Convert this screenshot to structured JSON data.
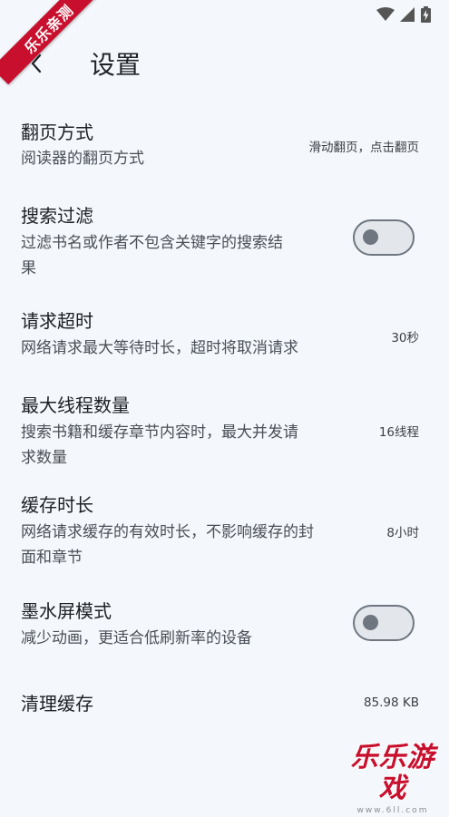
{
  "status_bar": {
    "icons": [
      "wifi-icon",
      "signal-icon",
      "battery-charging-icon"
    ]
  },
  "watermark": {
    "corner_text": "乐乐亲测",
    "bottom_text": "乐乐游戏",
    "bottom_url": "www.6ll.com"
  },
  "app_bar": {
    "back_icon": "chevron-left-icon",
    "title": "设置"
  },
  "settings": [
    {
      "title": "翻页方式",
      "description": "阅读器的翻页方式",
      "value": "滑动翻页，点击翻页"
    },
    {
      "title": "搜索过滤",
      "description": "过滤书名或作者不包含关键字的搜索结",
      "description_2": "果",
      "toggle_on": false
    },
    {
      "title": "请求超时",
      "description": "网络请求最大等待时长，超时将取消请求",
      "value": "30秒"
    },
    {
      "title": "最大线程数量",
      "description": "搜索书籍和缓存章节内容时，最大并发请",
      "description_2": "求数量",
      "value": "16线程"
    },
    {
      "title": "缓存时长",
      "description": "网络请求缓存的有效时长，不影响缓存的封",
      "description_2": "面和章节",
      "value": "8小时"
    },
    {
      "title": "墨水屏模式",
      "description": "减少动画，更适合低刷新率的设备",
      "toggle_on": false
    },
    {
      "title": "清理缓存",
      "value": "85.98 KB"
    }
  ],
  "colors": {
    "background": "#f4f7fb",
    "toggle_track": "#e3e7ec",
    "toggle_outline": "#6f7680",
    "watermark_red": "#c8102e"
  }
}
